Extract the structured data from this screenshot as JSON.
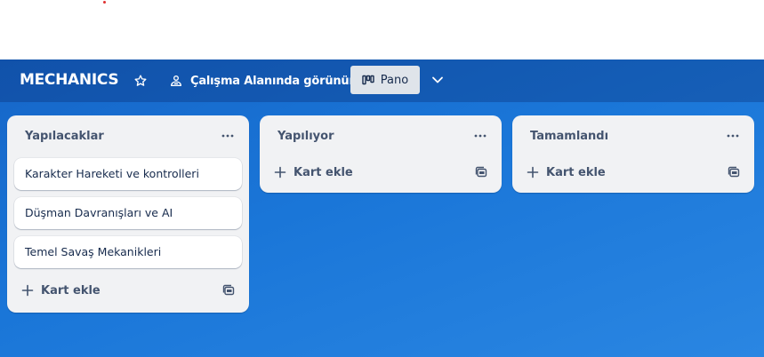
{
  "board": {
    "title": "MECHANICS",
    "visibility_label": "Çalışma Alanında görünür",
    "view_label": "Pano"
  },
  "lists": [
    {
      "title": "Yapılacaklar",
      "cards": [
        "Karakter Hareketi ve kontrolleri",
        "Düşman Davranışları ve AI",
        "Temel Savaş Mekanikleri"
      ],
      "add_label": "Kart ekle"
    },
    {
      "title": "Yapılıyor",
      "cards": [],
      "add_label": "Kart ekle"
    },
    {
      "title": "Tamamlandı",
      "cards": [],
      "add_label": "Kart ekle"
    }
  ],
  "colors": {
    "board_background": "#1a76d8",
    "header_overlay": "#1552a8",
    "list_background": "#f1f2f4",
    "card_background": "#ffffff",
    "text_dark": "#172b4d",
    "text_muted": "#44546f"
  },
  "icons": {
    "star": "star-icon",
    "visibility": "workspace-visibility-icon",
    "view": "board-view-icon",
    "chevron": "chevron-down-icon",
    "list_menu": "more-horizontal-icon",
    "add": "plus-icon",
    "template": "card-template-icon"
  }
}
